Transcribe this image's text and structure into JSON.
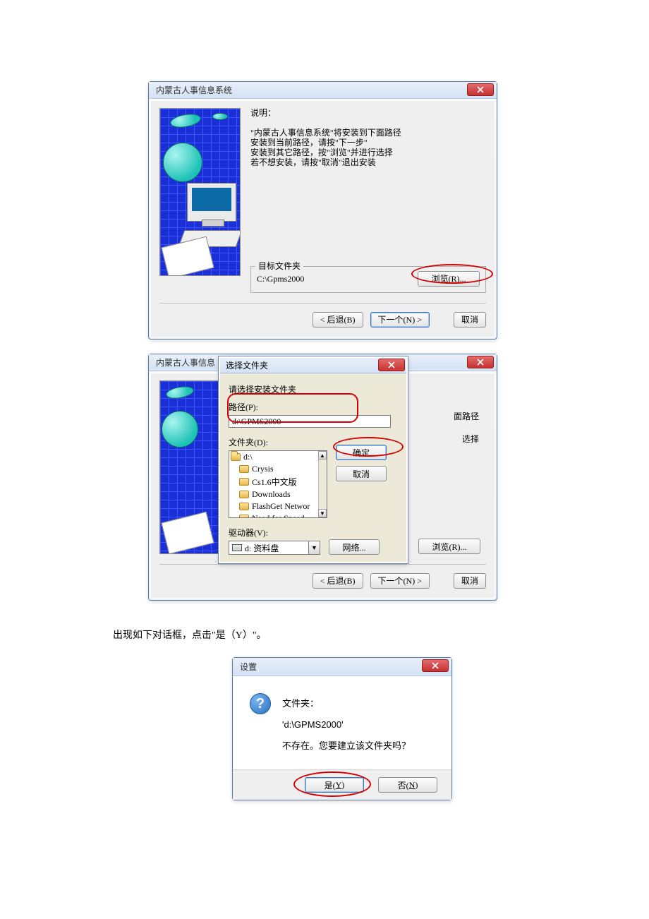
{
  "dialog1": {
    "title": "内蒙古人事信息系统",
    "desc_title": "说明：",
    "lines": [
      "\"内蒙古人事信息系统\"将安装到下面路径",
      "安装到当前路径，请按\"下一步\"",
      "安装到其它路径，按\"浏览\"并进行选择",
      "若不想安装，请按\"取消\"退出安装"
    ],
    "group_label": "目标文件夹",
    "path": "C:\\Gpms2000",
    "browse_btn": "浏览(R)...",
    "back_btn": "< 后退(B)",
    "next_btn": "下一个(N) >",
    "cancel_btn": "取消"
  },
  "dialog2": {
    "back_title": "内蒙古人事信息",
    "back_line1": "面路径",
    "back_line2": "选择",
    "title": "选择文件夹",
    "prompt": "请选择安装文件夹",
    "path_label": "路径(P):",
    "path_value": "d:\\GPMS2000",
    "folders_label": "文件夹(D):",
    "folders": [
      "d:\\",
      "Crysis",
      "Cs1.6中文版",
      "Downloads",
      "FlashGet Networ",
      "Need for Speed"
    ],
    "drive_label": "驱动器(V):",
    "drive_value": "d: 资料盘",
    "ok_btn": "确定",
    "cancel_btn": "取消",
    "network_btn": "网络...",
    "browse_btn": "浏览(R)...",
    "back_btn": "< 后退(B)",
    "next_btn": "下一个(N) >",
    "cancel_bar": "取消"
  },
  "narration": "出现如下对话框，点击\"是（Y）\"。",
  "dialog3": {
    "title": "设置",
    "line1": "文件夹：",
    "line2": "'d:\\GPMS2000'",
    "line3": "不存在。您要建立该文件夹吗？",
    "yes_label": "是(",
    "yes_accel": "Y",
    "yes_end": ")",
    "no_label": "否(",
    "no_accel": "N",
    "no_end": ")"
  }
}
